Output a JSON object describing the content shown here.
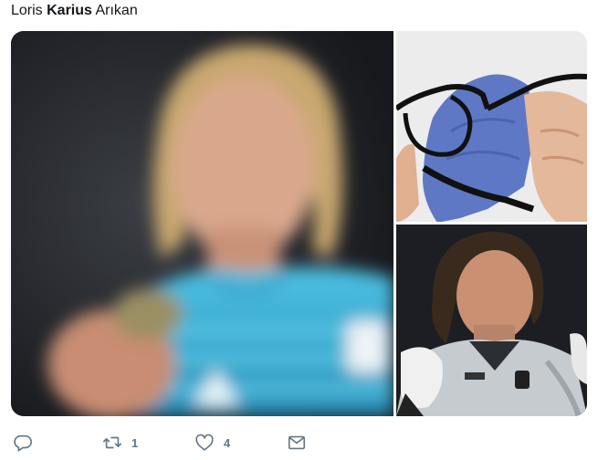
{
  "tweet": {
    "text_first": "Loris ",
    "text_bold": "Karius",
    "text_last": " Arıkan"
  },
  "media": {
    "images": [
      {
        "name": "blurred-goalkeeper-photo"
      },
      {
        "name": "glasses-cleaning-cloth-photo"
      },
      {
        "name": "goalkeeper-photo"
      }
    ]
  },
  "actions": {
    "reply_count": "",
    "retweet_count": "1",
    "like_count": "4",
    "icons": [
      "reply-icon",
      "retweet-icon",
      "like-icon",
      "direct-message-icon"
    ]
  },
  "colors": {
    "text": "#14171a",
    "icon": "#657786",
    "jersey": "#3fb3d8"
  }
}
